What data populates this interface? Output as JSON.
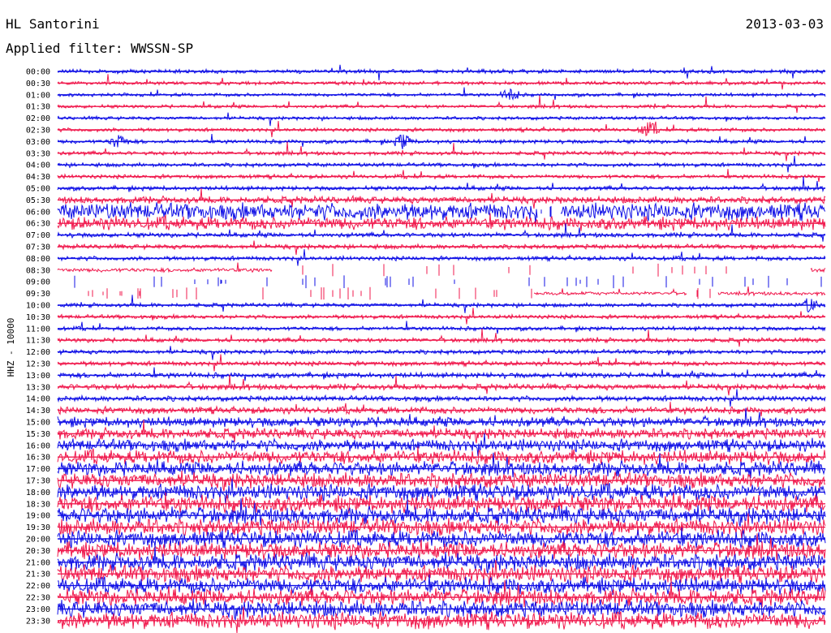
{
  "header": {
    "station": "HL Santorini",
    "date": "2013-03-03",
    "filter": "Applied filter: WWSSN-SP"
  },
  "channel_label": "HHZ - 10000",
  "colors": {
    "odd_trace": "#1010e6",
    "even_trace": "#f0194d",
    "background": "#ffffff",
    "text": "#000000"
  },
  "chart_data": {
    "type": "line",
    "title": "HL Santorini",
    "ylabel": "HHZ - 10000",
    "rows": [
      {
        "time": "00:00",
        "color": "blue",
        "activity": 0.15,
        "gaps": []
      },
      {
        "time": "00:30",
        "color": "red",
        "activity": 0.12,
        "gaps": []
      },
      {
        "time": "01:00",
        "color": "blue",
        "activity": 0.12,
        "events": [
          0.59
        ],
        "gaps": []
      },
      {
        "time": "01:30",
        "color": "red",
        "activity": 0.12,
        "gaps": []
      },
      {
        "time": "02:00",
        "color": "blue",
        "activity": 0.12,
        "gaps": []
      },
      {
        "time": "02:30",
        "color": "red",
        "activity": 0.14,
        "events": [
          0.77
        ],
        "gaps": []
      },
      {
        "time": "03:00",
        "color": "blue",
        "activity": 0.15,
        "events": [
          0.08,
          0.45
        ],
        "gaps": []
      },
      {
        "time": "03:30",
        "color": "red",
        "activity": 0.15,
        "gaps": []
      },
      {
        "time": "04:00",
        "color": "blue",
        "activity": 0.16,
        "gaps": []
      },
      {
        "time": "04:30",
        "color": "red",
        "activity": 0.16,
        "gaps": []
      },
      {
        "time": "05:00",
        "color": "blue",
        "activity": 0.18,
        "gaps": []
      },
      {
        "time": "05:30",
        "color": "red",
        "activity": 0.35,
        "gaps": []
      },
      {
        "time": "06:00",
        "color": "blue",
        "activity": 1.0,
        "gaps": [
          [
            0.625,
            0.655
          ]
        ]
      },
      {
        "time": "06:30",
        "color": "red",
        "activity": 0.75,
        "gaps": []
      },
      {
        "time": "07:00",
        "color": "blue",
        "activity": 0.2,
        "gaps": []
      },
      {
        "time": "07:30",
        "color": "red",
        "activity": 0.2,
        "gaps": []
      },
      {
        "time": "08:00",
        "color": "blue",
        "activity": 0.18,
        "gaps": []
      },
      {
        "time": "08:30",
        "color": "red",
        "activity": 0.15,
        "gaps": [
          [
            0.28,
            0.98
          ]
        ]
      },
      {
        "time": "09:00",
        "color": "blue",
        "activity": 0.1,
        "gaps": [
          [
            0.0,
            1.0
          ]
        ]
      },
      {
        "time": "09:30",
        "color": "red",
        "activity": 0.12,
        "gaps": [
          [
            0.0,
            0.62
          ],
          [
            0.82,
            0.86
          ]
        ]
      },
      {
        "time": "10:00",
        "color": "blue",
        "activity": 0.16,
        "events": [
          0.98
        ],
        "gaps": []
      },
      {
        "time": "10:30",
        "color": "red",
        "activity": 0.16,
        "gaps": []
      },
      {
        "time": "11:00",
        "color": "blue",
        "activity": 0.16,
        "gaps": []
      },
      {
        "time": "11:30",
        "color": "red",
        "activity": 0.18,
        "gaps": []
      },
      {
        "time": "12:00",
        "color": "blue",
        "activity": 0.18,
        "gaps": []
      },
      {
        "time": "12:30",
        "color": "red",
        "activity": 0.2,
        "gaps": []
      },
      {
        "time": "13:00",
        "color": "blue",
        "activity": 0.25,
        "gaps": []
      },
      {
        "time": "13:30",
        "color": "red",
        "activity": 0.28,
        "gaps": []
      },
      {
        "time": "14:00",
        "color": "blue",
        "activity": 0.25,
        "gaps": []
      },
      {
        "time": "14:30",
        "color": "red",
        "activity": 0.35,
        "gaps": []
      },
      {
        "time": "15:00",
        "color": "blue",
        "activity": 0.55,
        "gaps": []
      },
      {
        "time": "15:30",
        "color": "red",
        "activity": 0.6,
        "gaps": []
      },
      {
        "time": "16:00",
        "color": "blue",
        "activity": 0.7,
        "gaps": []
      },
      {
        "time": "16:30",
        "color": "red",
        "activity": 0.8,
        "gaps": []
      },
      {
        "time": "17:00",
        "color": "blue",
        "activity": 0.85,
        "gaps": []
      },
      {
        "time": "17:30",
        "color": "red",
        "activity": 0.9,
        "gaps": []
      },
      {
        "time": "18:00",
        "color": "blue",
        "activity": 0.95,
        "gaps": []
      },
      {
        "time": "18:30",
        "color": "red",
        "activity": 1.0,
        "gaps": []
      },
      {
        "time": "19:00",
        "color": "blue",
        "activity": 1.0,
        "gaps": []
      },
      {
        "time": "19:30",
        "color": "red",
        "activity": 1.0,
        "gaps": []
      },
      {
        "time": "20:00",
        "color": "blue",
        "activity": 1.0,
        "gaps": []
      },
      {
        "time": "20:30",
        "color": "red",
        "activity": 1.0,
        "gaps": []
      },
      {
        "time": "21:00",
        "color": "blue",
        "activity": 1.0,
        "gaps": []
      },
      {
        "time": "21:30",
        "color": "red",
        "activity": 1.0,
        "gaps": []
      },
      {
        "time": "22:00",
        "color": "blue",
        "activity": 0.95,
        "gaps": []
      },
      {
        "time": "22:30",
        "color": "red",
        "activity": 1.0,
        "gaps": []
      },
      {
        "time": "23:00",
        "color": "blue",
        "activity": 1.0,
        "gaps": []
      },
      {
        "time": "23:30",
        "color": "red",
        "activity": 1.0,
        "gaps": []
      }
    ]
  }
}
